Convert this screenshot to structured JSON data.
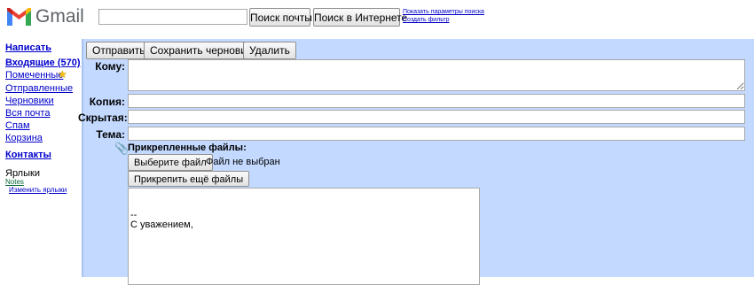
{
  "header": {
    "logo_text": "Gmail",
    "search_value": "",
    "search_mail_button": "Поиск почты",
    "search_web_button": "Поиск в Интернете",
    "show_search_options": "Показать параметры поиска",
    "create_filter": "Создать фильтр"
  },
  "sidebar": {
    "compose": "Написать",
    "inbox": "Входящие (570)",
    "starred": "Помеченные",
    "sent": "Отправленные",
    "drafts": "Черновики",
    "all_mail": "Вся почта",
    "spam": "Спам",
    "trash": "Корзина",
    "contacts": "Контакты",
    "labels_header": "Ярлыки",
    "label_notes": "Notes",
    "edit_labels": "Изменить ярлыки"
  },
  "toolbar": {
    "send": "Отправить",
    "save_draft": "Сохранить черновик",
    "delete": "Удалить"
  },
  "compose": {
    "to_label": "Кому:",
    "cc_label": "Копия:",
    "bcc_label": "Скрытая:",
    "subject_label": "Тема:",
    "to_value": "",
    "cc_value": "",
    "bcc_value": "",
    "subject_value": "",
    "attachments_label": "Прикрепленные файлы:",
    "choose_file": "Выберите файл",
    "no_file": "Файл не выбран",
    "attach_more": "Прикрепить ещё файлы",
    "signature_dash": "--",
    "signature_text": "С уважением,"
  },
  "colors": {
    "panel": "#c3d9ff",
    "link": "#0000cc",
    "label_green": "#006633"
  }
}
